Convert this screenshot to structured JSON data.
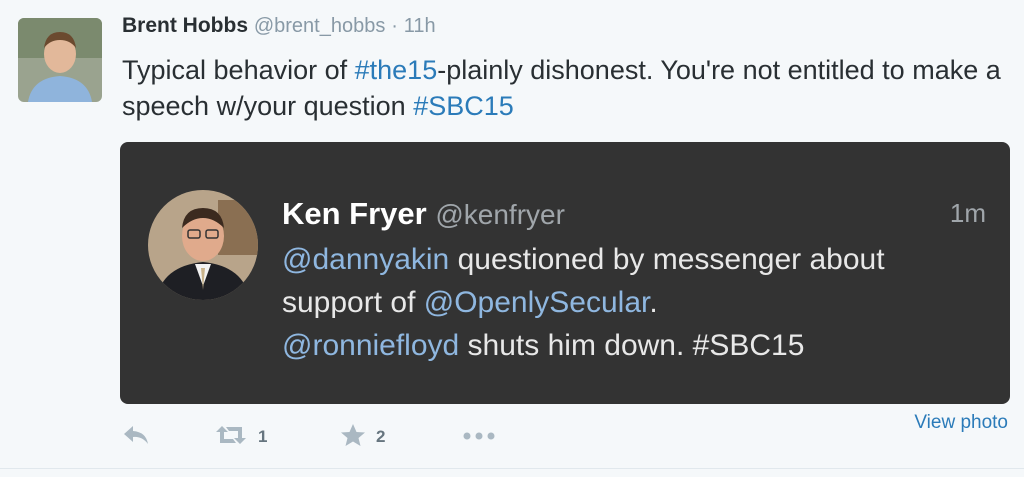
{
  "tweet": {
    "author_name": "Brent Hobbs",
    "author_handle": "@brent_hobbs",
    "separator": "·",
    "time": "11h",
    "text_part1": "Typical behavior of ",
    "hashtag1": "#the15",
    "text_part2": "-plainly dishonest. You're not entitled to make a speech w/your question ",
    "hashtag2": "#SBC15"
  },
  "card": {
    "author_name": "Ken Fryer",
    "author_handle": "@kenfryer",
    "time": "1m",
    "mention1": "@dannyakin",
    "text1": " questioned by messenger about support of ",
    "mention2": "@OpenlySecular",
    "text2": ".",
    "mention3": "@ronniefloyd",
    "text3": " shuts him down. #SBC15"
  },
  "actions": {
    "reply_icon": "reply-icon",
    "retweet_icon": "retweet-icon",
    "retweet_count": "1",
    "favorite_icon": "star-icon",
    "favorite_count": "2",
    "more_icon": "more-icon"
  },
  "view_photo_label": "View photo",
  "colors": {
    "link": "#2b7bb9",
    "card_bg": "#333333",
    "card_mention": "#8fb7e0"
  }
}
